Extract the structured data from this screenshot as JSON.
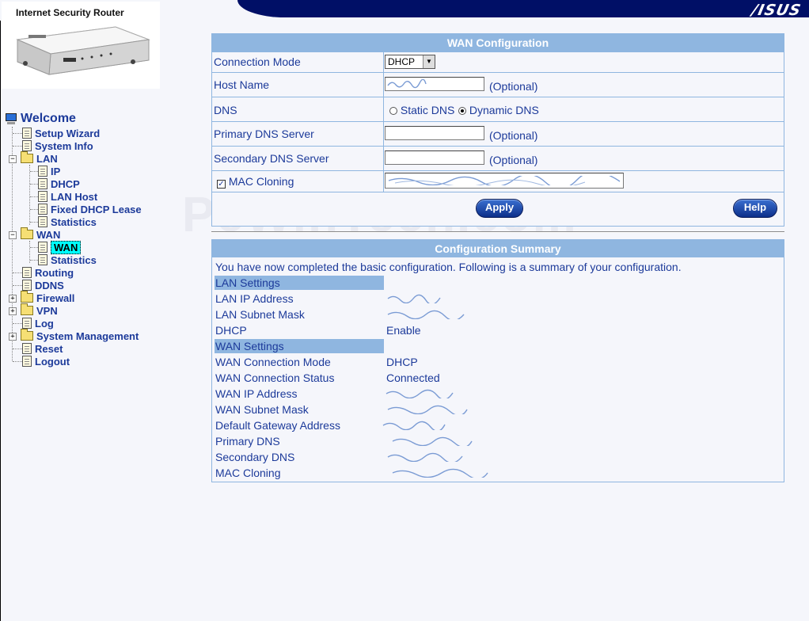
{
  "brand": {
    "logo": "/ISUS",
    "product_title": "Internet Security Router"
  },
  "watermark": "PcWinTech.com",
  "tree": {
    "welcome": "Welcome",
    "setup_wizard": "Setup Wizard",
    "system_info": "System Info",
    "lan": "LAN",
    "lan_ip": "IP",
    "lan_dhcp": "DHCP",
    "lan_host": "LAN Host",
    "lan_fixed": "Fixed DHCP Lease",
    "lan_stats": "Statistics",
    "wan": "WAN",
    "wan_wan": "WAN",
    "wan_stats": "Statistics",
    "routing": "Routing",
    "ddns": "DDNS",
    "firewall": "Firewall",
    "vpn": "VPN",
    "log": "Log",
    "system_management": "System Management",
    "reset": "Reset",
    "logout": "Logout"
  },
  "wan_config": {
    "title": "WAN Configuration",
    "connection_mode_label": "Connection Mode",
    "connection_mode_value": "DHCP",
    "host_name_label": "Host Name",
    "optional": "(Optional)",
    "dns_label": "DNS",
    "static_dns": "Static DNS",
    "dynamic_dns": "Dynamic DNS",
    "primary_dns_label": "Primary DNS Server",
    "secondary_dns_label": "Secondary DNS Server",
    "mac_cloning_label": "MAC Cloning",
    "apply": "Apply",
    "help": "Help"
  },
  "summary": {
    "title": "Configuration Summary",
    "intro": "You have now completed the basic configuration. Following is a summary of your configuration.",
    "lan_settings": "LAN Settings",
    "lan_ip_label": "LAN IP Address",
    "lan_mask_label": "LAN Subnet Mask",
    "dhcp_label": "DHCP",
    "dhcp_value": "Enable",
    "wan_settings": "WAN Settings",
    "wan_mode_label": "WAN Connection Mode",
    "wan_mode_value": "DHCP",
    "wan_status_label": "WAN Connection Status",
    "wan_status_value": "Connected",
    "wan_ip_label": "WAN IP Address",
    "wan_mask_label": "WAN Subnet Mask",
    "gateway_label": "Default Gateway Address",
    "primary_dns_label": "Primary DNS",
    "secondary_dns_label": "Secondary DNS",
    "mac_cloning_label": "MAC Cloning"
  },
  "colors": {
    "navy": "#000f66",
    "panel_blue": "#8fb6e0",
    "link_blue": "#1c3a9a",
    "selection": "#00ffff"
  }
}
